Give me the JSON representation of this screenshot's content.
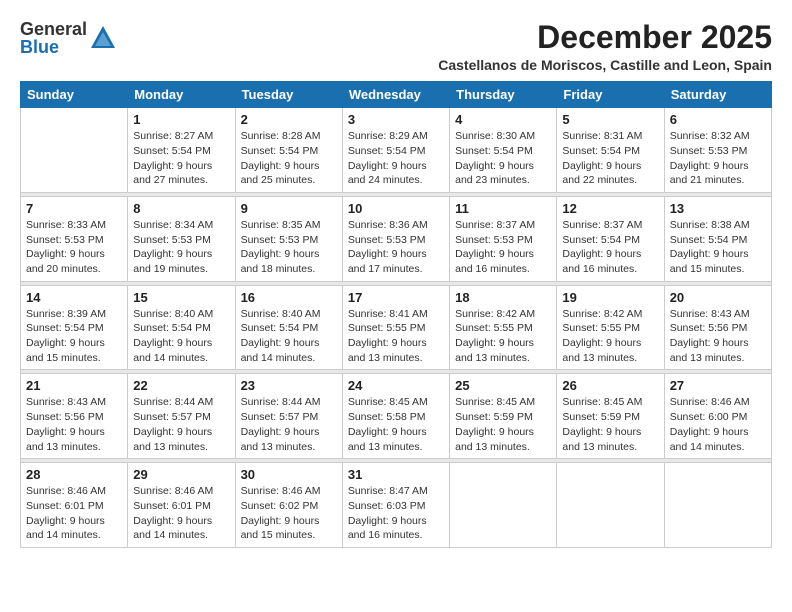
{
  "header": {
    "logo_general": "General",
    "logo_blue": "Blue",
    "month_title": "December 2025",
    "location": "Castellanos de Moriscos, Castille and Leon, Spain"
  },
  "columns": [
    "Sunday",
    "Monday",
    "Tuesday",
    "Wednesday",
    "Thursday",
    "Friday",
    "Saturday"
  ],
  "weeks": [
    [
      {
        "day": "",
        "info": ""
      },
      {
        "day": "1",
        "info": "Sunrise: 8:27 AM\nSunset: 5:54 PM\nDaylight: 9 hours\nand 27 minutes."
      },
      {
        "day": "2",
        "info": "Sunrise: 8:28 AM\nSunset: 5:54 PM\nDaylight: 9 hours\nand 25 minutes."
      },
      {
        "day": "3",
        "info": "Sunrise: 8:29 AM\nSunset: 5:54 PM\nDaylight: 9 hours\nand 24 minutes."
      },
      {
        "day": "4",
        "info": "Sunrise: 8:30 AM\nSunset: 5:54 PM\nDaylight: 9 hours\nand 23 minutes."
      },
      {
        "day": "5",
        "info": "Sunrise: 8:31 AM\nSunset: 5:54 PM\nDaylight: 9 hours\nand 22 minutes."
      },
      {
        "day": "6",
        "info": "Sunrise: 8:32 AM\nSunset: 5:53 PM\nDaylight: 9 hours\nand 21 minutes."
      }
    ],
    [
      {
        "day": "7",
        "info": "Sunrise: 8:33 AM\nSunset: 5:53 PM\nDaylight: 9 hours\nand 20 minutes."
      },
      {
        "day": "8",
        "info": "Sunrise: 8:34 AM\nSunset: 5:53 PM\nDaylight: 9 hours\nand 19 minutes."
      },
      {
        "day": "9",
        "info": "Sunrise: 8:35 AM\nSunset: 5:53 PM\nDaylight: 9 hours\nand 18 minutes."
      },
      {
        "day": "10",
        "info": "Sunrise: 8:36 AM\nSunset: 5:53 PM\nDaylight: 9 hours\nand 17 minutes."
      },
      {
        "day": "11",
        "info": "Sunrise: 8:37 AM\nSunset: 5:53 PM\nDaylight: 9 hours\nand 16 minutes."
      },
      {
        "day": "12",
        "info": "Sunrise: 8:37 AM\nSunset: 5:54 PM\nDaylight: 9 hours\nand 16 minutes."
      },
      {
        "day": "13",
        "info": "Sunrise: 8:38 AM\nSunset: 5:54 PM\nDaylight: 9 hours\nand 15 minutes."
      }
    ],
    [
      {
        "day": "14",
        "info": "Sunrise: 8:39 AM\nSunset: 5:54 PM\nDaylight: 9 hours\nand 15 minutes."
      },
      {
        "day": "15",
        "info": "Sunrise: 8:40 AM\nSunset: 5:54 PM\nDaylight: 9 hours\nand 14 minutes."
      },
      {
        "day": "16",
        "info": "Sunrise: 8:40 AM\nSunset: 5:54 PM\nDaylight: 9 hours\nand 14 minutes."
      },
      {
        "day": "17",
        "info": "Sunrise: 8:41 AM\nSunset: 5:55 PM\nDaylight: 9 hours\nand 13 minutes."
      },
      {
        "day": "18",
        "info": "Sunrise: 8:42 AM\nSunset: 5:55 PM\nDaylight: 9 hours\nand 13 minutes."
      },
      {
        "day": "19",
        "info": "Sunrise: 8:42 AM\nSunset: 5:55 PM\nDaylight: 9 hours\nand 13 minutes."
      },
      {
        "day": "20",
        "info": "Sunrise: 8:43 AM\nSunset: 5:56 PM\nDaylight: 9 hours\nand 13 minutes."
      }
    ],
    [
      {
        "day": "21",
        "info": "Sunrise: 8:43 AM\nSunset: 5:56 PM\nDaylight: 9 hours\nand 13 minutes."
      },
      {
        "day": "22",
        "info": "Sunrise: 8:44 AM\nSunset: 5:57 PM\nDaylight: 9 hours\nand 13 minutes."
      },
      {
        "day": "23",
        "info": "Sunrise: 8:44 AM\nSunset: 5:57 PM\nDaylight: 9 hours\nand 13 minutes."
      },
      {
        "day": "24",
        "info": "Sunrise: 8:45 AM\nSunset: 5:58 PM\nDaylight: 9 hours\nand 13 minutes."
      },
      {
        "day": "25",
        "info": "Sunrise: 8:45 AM\nSunset: 5:59 PM\nDaylight: 9 hours\nand 13 minutes."
      },
      {
        "day": "26",
        "info": "Sunrise: 8:45 AM\nSunset: 5:59 PM\nDaylight: 9 hours\nand 13 minutes."
      },
      {
        "day": "27",
        "info": "Sunrise: 8:46 AM\nSunset: 6:00 PM\nDaylight: 9 hours\nand 14 minutes."
      }
    ],
    [
      {
        "day": "28",
        "info": "Sunrise: 8:46 AM\nSunset: 6:01 PM\nDaylight: 9 hours\nand 14 minutes."
      },
      {
        "day": "29",
        "info": "Sunrise: 8:46 AM\nSunset: 6:01 PM\nDaylight: 9 hours\nand 14 minutes."
      },
      {
        "day": "30",
        "info": "Sunrise: 8:46 AM\nSunset: 6:02 PM\nDaylight: 9 hours\nand 15 minutes."
      },
      {
        "day": "31",
        "info": "Sunrise: 8:47 AM\nSunset: 6:03 PM\nDaylight: 9 hours\nand 16 minutes."
      },
      {
        "day": "",
        "info": ""
      },
      {
        "day": "",
        "info": ""
      },
      {
        "day": "",
        "info": ""
      }
    ]
  ]
}
